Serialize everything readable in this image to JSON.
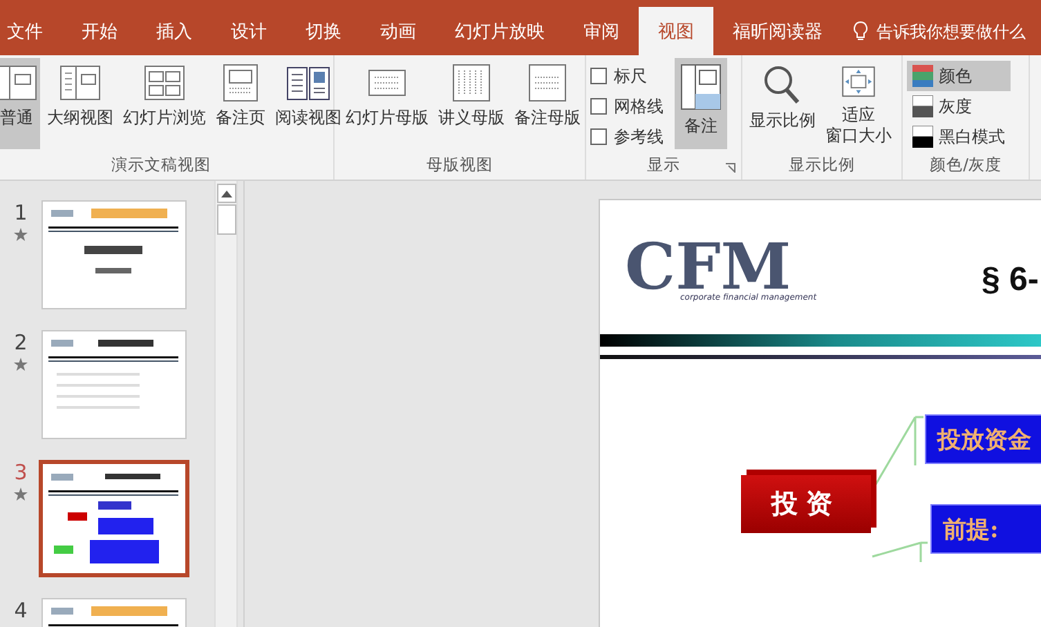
{
  "tabs": [
    {
      "label": "文件",
      "selected": false
    },
    {
      "label": "开始",
      "selected": false
    },
    {
      "label": "插入",
      "selected": false
    },
    {
      "label": "设计",
      "selected": false
    },
    {
      "label": "切换",
      "selected": false
    },
    {
      "label": "动画",
      "selected": false
    },
    {
      "label": "幻灯片放映",
      "selected": false
    },
    {
      "label": "审阅",
      "selected": false
    },
    {
      "label": "视图",
      "selected": true
    },
    {
      "label": "福昕阅读器",
      "selected": false
    }
  ],
  "tell_me": {
    "placeholder": "告诉我你想要做什么"
  },
  "ribbon": {
    "presentation_views": {
      "label": "演示文稿视图",
      "buttons": [
        {
          "label": "普通",
          "selected": true
        },
        {
          "label": "大纲视图",
          "selected": false
        },
        {
          "label": "幻灯片浏览",
          "selected": false
        },
        {
          "label": "备注页",
          "selected": false
        },
        {
          "label": "阅读视图",
          "selected": false
        }
      ]
    },
    "master_views": {
      "label": "母版视图",
      "buttons": [
        "幻灯片母版",
        "讲义母版",
        "备注母版"
      ]
    },
    "show": {
      "label": "显示",
      "checkboxes": [
        {
          "label": "标尺",
          "checked": false
        },
        {
          "label": "网格线",
          "checked": false
        },
        {
          "label": "参考线",
          "checked": false
        }
      ],
      "notes": {
        "label": "备注",
        "selected": true
      }
    },
    "zoom": {
      "label": "显示比例",
      "buttons": [
        {
          "lines": [
            "显示比例"
          ]
        },
        {
          "lines": [
            "适应",
            "窗口大小"
          ]
        }
      ]
    },
    "color_grayscale": {
      "label": "颜色/灰度",
      "modes": [
        {
          "label": "颜色",
          "selected": true
        },
        {
          "label": "灰度",
          "selected": false
        },
        {
          "label": "黑白模式",
          "selected": false
        }
      ]
    }
  },
  "slides": [
    {
      "number": "1",
      "animated": true,
      "selected": false,
      "kind": "title"
    },
    {
      "number": "2",
      "animated": true,
      "selected": false,
      "kind": "list"
    },
    {
      "number": "3",
      "animated": true,
      "selected": true,
      "kind": "diagram"
    },
    {
      "number": "4",
      "animated": false,
      "selected": false,
      "kind": "title"
    }
  ],
  "slide": {
    "logo": {
      "mark": "CFM",
      "tagline": "corporate financial management"
    },
    "title": "§ 6-",
    "topic": "投资",
    "branches": [
      "投放资金",
      "前提:"
    ]
  }
}
